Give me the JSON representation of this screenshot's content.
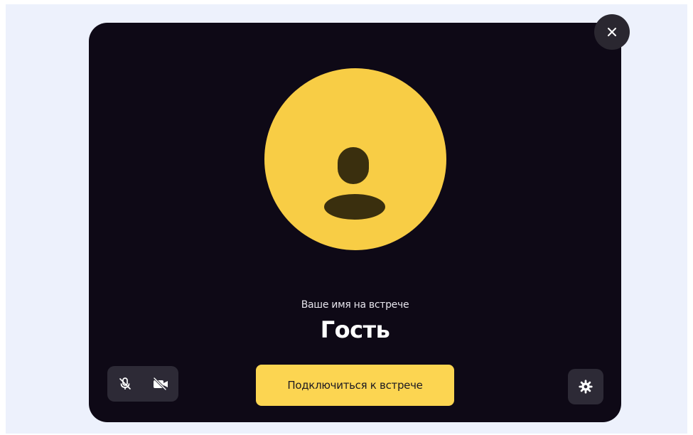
{
  "dialog": {
    "name_caption": "Ваше имя на встрече",
    "name_value": "Гость",
    "join_button_label": "Подключиться к встрече"
  },
  "icons": {
    "close": "close-icon",
    "avatar": "user-icon",
    "microphone": "microphone-off-icon",
    "camera": "camera-off-icon",
    "settings": "gear-icon"
  },
  "colors": {
    "backdrop": "#edf1fc",
    "dialog_background": "#0e0916",
    "avatar_fill": "#f8cd45",
    "avatar_glyph": "#3a2f0e",
    "join_button": "#fcd551",
    "control_background": "#2d2a36"
  }
}
